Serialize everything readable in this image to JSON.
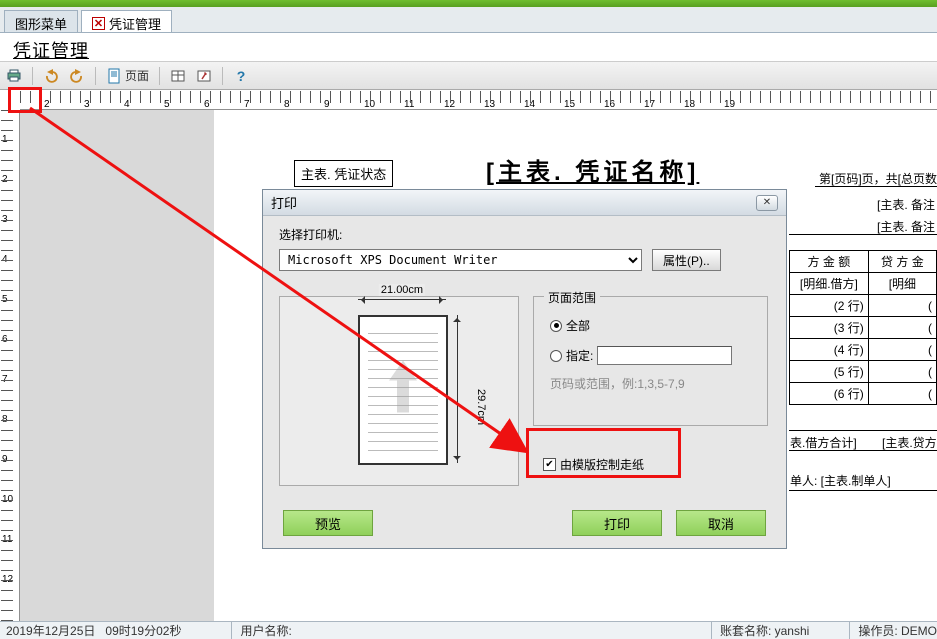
{
  "tabs": {
    "graph_menu": "图形菜单",
    "voucher_mgmt": "凭证管理"
  },
  "page_title": "凭证管理",
  "toolbar": {
    "page_btn": "页面"
  },
  "report": {
    "status_field": "主表. 凭证状态",
    "main_title": "[主表. 凭证名称]",
    "pager_text": "第[页码]页，共[总页数",
    "remark1": "[主表. 备注",
    "remark2": "[主表. 备注",
    "header_debit": "方 金 额",
    "header_credit": "贷 方 金",
    "sub_debit": "[明细.借方]",
    "sub_credit": "[明细",
    "rows": [
      "(2 行)",
      "(3 行)",
      "(4 行)",
      "(5 行)",
      "(6 行)"
    ],
    "row_zero_suffix": "(",
    "total_debit_label": "表.借方合计]",
    "total_credit_label": "[主表.贷方",
    "maker_label": "单人: [主表.制单人]"
  },
  "dialog": {
    "title": "打印",
    "select_printer_label": "选择打印机:",
    "selected_printer": "Microsoft XPS Document Writer",
    "properties_btn": "属性(P)..",
    "paper_width": "21.00cm",
    "paper_height": "29.7cm",
    "range_group": "页面范围",
    "range_all": "全部",
    "range_specify": "指定:",
    "range_hint": "页码或范围，例:1,3,5-7,9",
    "checkbox_template_feed": "由模版控制走纸",
    "preview_btn": "预览",
    "print_btn": "打印",
    "cancel_btn": "取消"
  },
  "statusbar": {
    "date": "2019年12月25日",
    "time": "09时19分02秒",
    "user_label": "用户名称:",
    "account_label": "账套名称:",
    "account_value": "yanshi",
    "operator_label": "操作员:",
    "operator_value": "DEMO"
  },
  "ruler_h": [
    "2",
    "3",
    "4",
    "5",
    "6",
    "7",
    "8",
    "9",
    "10",
    "11",
    "12",
    "13",
    "14",
    "15",
    "16",
    "17",
    "18",
    "19"
  ],
  "ruler_v": [
    "1",
    "2",
    "3",
    "4",
    "5",
    "6",
    "7",
    "8",
    "9",
    "10",
    "11",
    "12"
  ]
}
